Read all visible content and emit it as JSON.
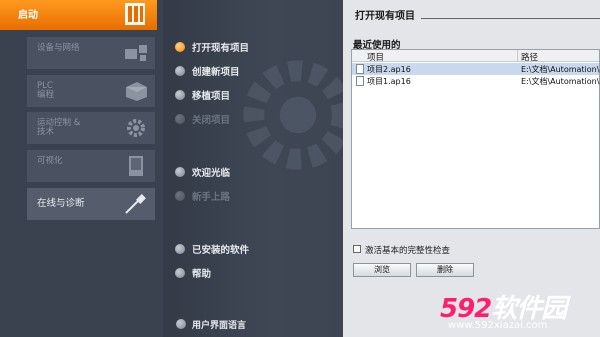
{
  "start": {
    "label": "启动",
    "icon": "portal-start-icon"
  },
  "portal_tiles": [
    {
      "label": "设备与网络",
      "icon": "devices-network-icon",
      "active": false
    },
    {
      "label": "PLC\n编程",
      "icon": "plc-programming-icon",
      "active": false
    },
    {
      "label": "运动控制 &\n技术",
      "icon": "motion-control-gear-icon",
      "active": false
    },
    {
      "label": "可视化",
      "icon": "visualization-panel-icon",
      "active": false
    },
    {
      "label": "在线与诊断",
      "icon": "online-diagnostics-probe-icon",
      "active": true
    }
  ],
  "actions": [
    {
      "label": "打开现有项目",
      "state": "selected"
    },
    {
      "label": "创建新项目",
      "state": "enabled"
    },
    {
      "label": "移植项目",
      "state": "enabled"
    },
    {
      "label": "关闭项目",
      "state": "disabled"
    },
    {
      "label": "欢迎光临",
      "state": "enabled"
    },
    {
      "label": "新手上路",
      "state": "disabled"
    },
    {
      "label": "已安装的软件",
      "state": "enabled"
    },
    {
      "label": "帮助",
      "state": "enabled"
    }
  ],
  "language": {
    "label": "用户界面语言"
  },
  "panel": {
    "title": "打开现有项目",
    "recent_label": "最近使用的",
    "columns": [
      "项目",
      "路径"
    ],
    "rows": [
      {
        "name": "项目2.ap16",
        "path": "E:\\文档\\Automation\\项",
        "selected": true
      },
      {
        "name": "项目1.ap16",
        "path": "E:\\文档\\Automation\\项",
        "selected": false
      }
    ],
    "checkbox_label": "激活基本的完整性检查",
    "checkbox_checked": false,
    "browse_button": "浏览",
    "delete_button": "删除"
  },
  "watermark": {
    "logo_numbers": "592",
    "logo_text": "软件园",
    "url": "www.592xiazai.com"
  },
  "colors": {
    "accent": "#f28a00",
    "brand": "#ff1e6d",
    "selection": "#c8d9ef"
  }
}
